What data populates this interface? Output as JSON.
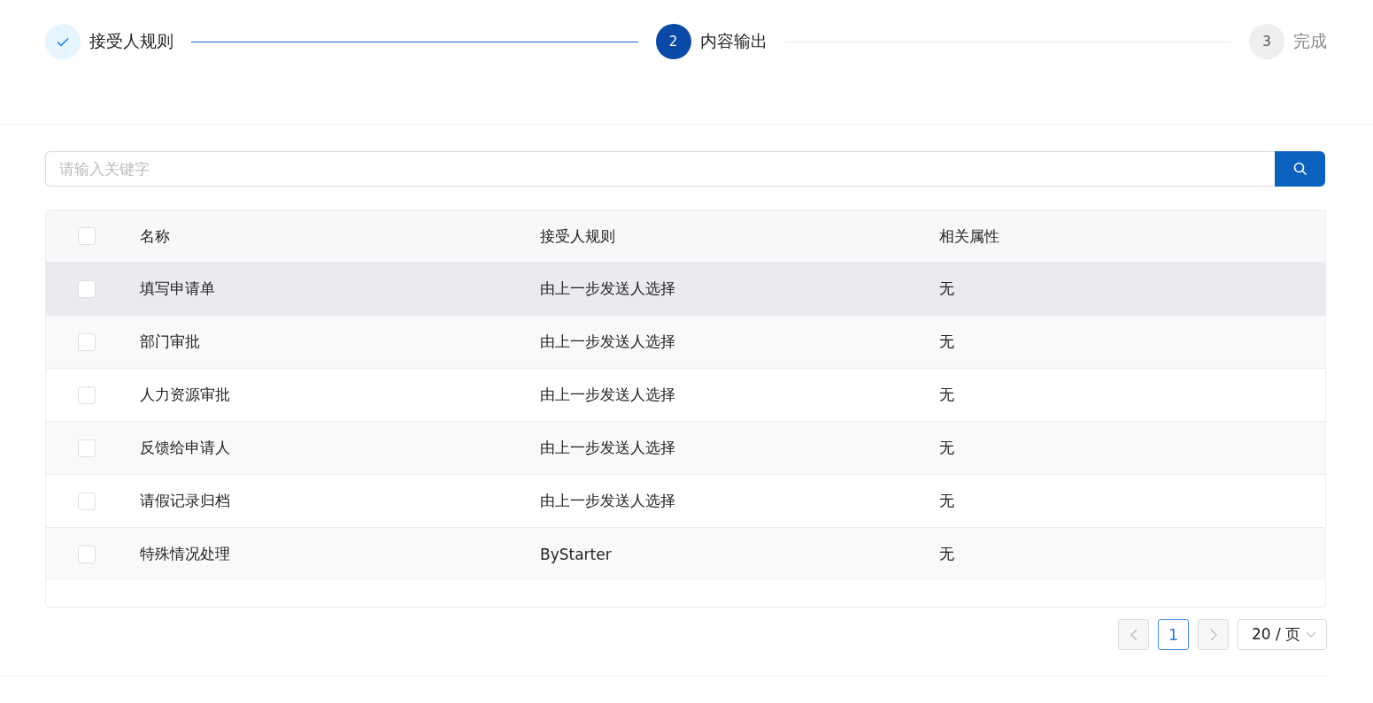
{
  "steps": [
    {
      "label": "接受人规则",
      "done": true,
      "active": false
    },
    {
      "number": "2",
      "label": "内容输出",
      "done": false,
      "active": true
    },
    {
      "number": "3",
      "label": "完成",
      "done": false,
      "active": false
    }
  ],
  "search": {
    "placeholder": "请输入关键字"
  },
  "table": {
    "header_checked": false,
    "columns": [
      "名称",
      "接受人规则",
      "相关属性"
    ],
    "rows": [
      {
        "checked": false,
        "hovered": true,
        "cells": [
          "填写申请单",
          "由上一步发送人选择",
          "无"
        ]
      },
      {
        "checked": false,
        "hovered": false,
        "cells": [
          "部门审批",
          "由上一步发送人选择",
          "无"
        ]
      },
      {
        "checked": false,
        "hovered": false,
        "cells": [
          "人力资源审批",
          "由上一步发送人选择",
          "无"
        ]
      },
      {
        "checked": false,
        "hovered": false,
        "cells": [
          "反馈给申请人",
          "由上一步发送人选择",
          "无"
        ]
      },
      {
        "checked": false,
        "hovered": false,
        "cells": [
          "请假记录归档",
          "由上一步发送人选择",
          "无"
        ]
      },
      {
        "checked": false,
        "hovered": false,
        "cells": [
          "特殊情况处理",
          "ByStarter",
          "无"
        ]
      }
    ]
  },
  "pagination": {
    "pages": [
      {
        "label": "1",
        "selected": true
      }
    ],
    "page_size": "20 / 页"
  }
}
